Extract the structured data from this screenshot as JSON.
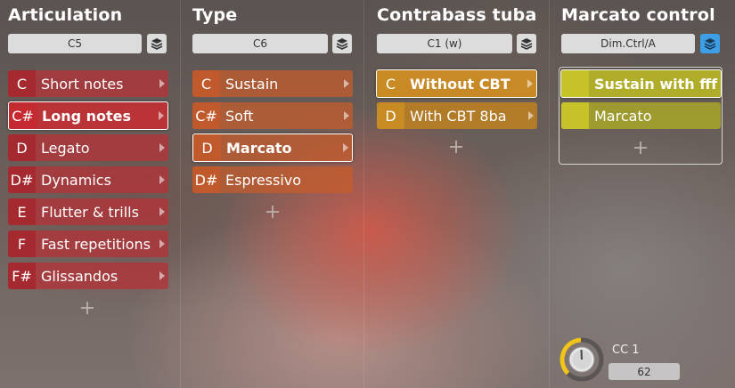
{
  "columns": [
    {
      "title": "Articulation",
      "selector": "C5",
      "items": [
        {
          "key": "C",
          "label": "Short notes"
        },
        {
          "key": "C#",
          "label": "Long notes"
        },
        {
          "key": "D",
          "label": "Legato"
        },
        {
          "key": "D#",
          "label": "Dynamics"
        },
        {
          "key": "E",
          "label": "Flutter & trills"
        },
        {
          "key": "F",
          "label": "Fast repetitions"
        },
        {
          "key": "F#",
          "label": "Glissandos"
        }
      ],
      "selected_index": 1
    },
    {
      "title": "Type",
      "selector": "C6",
      "items": [
        {
          "key": "C",
          "label": "Sustain"
        },
        {
          "key": "C#",
          "label": "Soft"
        },
        {
          "key": "D",
          "label": "Marcato"
        },
        {
          "key": "D#",
          "label": "Espressivo"
        }
      ],
      "selected_index": 2
    },
    {
      "title": "Contrabass tuba",
      "selector": "C1 (w)",
      "items": [
        {
          "key": "C",
          "label": "Without CBT"
        },
        {
          "key": "D",
          "label": "With CBT 8ba"
        }
      ],
      "selected_index": 0
    },
    {
      "title": "Marcato control",
      "selector": "Dim.Ctrl/A",
      "items": [
        {
          "key": "",
          "label": "Sustain with fff"
        },
        {
          "key": "",
          "label": "Marcato"
        }
      ],
      "selected_index": 0
    }
  ],
  "knob": {
    "label": "CC 1",
    "value": "62",
    "level": 0.49,
    "accent_color": "#f0c419"
  },
  "colors": {
    "articulation": "#b0343a",
    "type": "#c45c2c",
    "tuba": "#c88a22",
    "control": "#c6c228",
    "layers_active": "#3e9ee6"
  },
  "icons": {
    "layers": "layers-icon",
    "chevron": "chevron-right-icon",
    "add": "plus-icon"
  }
}
